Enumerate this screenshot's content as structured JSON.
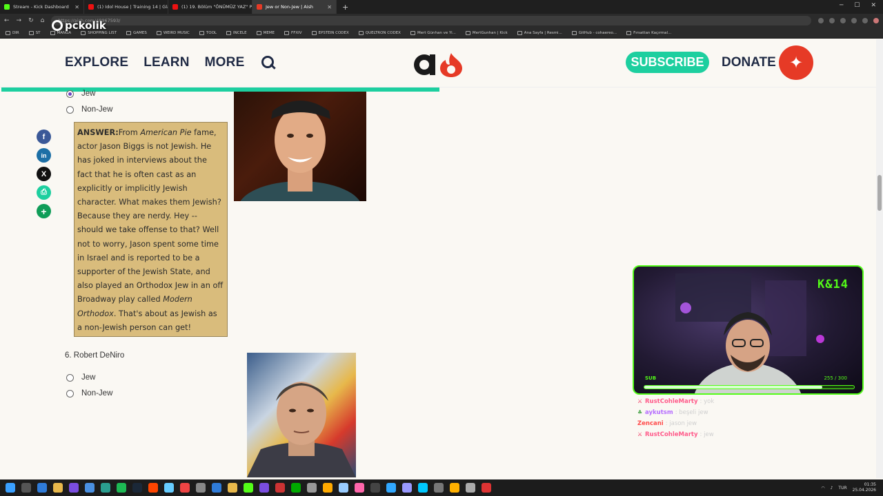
{
  "browser": {
    "tabs": [
      {
        "title": "Stream - Kick Dashboard",
        "color": "#53fc18",
        "active": false
      },
      {
        "title": "(1) Idol House | Training 14 | Glam",
        "color": "#e11",
        "active": false
      },
      {
        "title": "(1) 19. Bölüm \"ÖNÜMÜZ YAZ\" Pe",
        "color": "#e11",
        "active": false
      },
      {
        "title": "Jew or Non-Jew | Aish",
        "color": "#e63a26",
        "active": true
      }
    ],
    "new_tab": "+",
    "url": "https://aish.com/48967593/",
    "bookmarks": [
      "DIR",
      "ST",
      "MANGA",
      "SHOPPING LIST",
      "GAMES",
      "WEIRD MUSIC",
      "TOOL",
      "INCELE",
      "MEME",
      "FFXIV",
      "EPSTEIN CODEX",
      "QUELTRON CODEX",
      "Mert Günhan ve Yi...",
      "MertGunhan | Kick",
      "Ana Sayfa | Resmi...",
      "GitHub - cohaereo...",
      "Fırsattan Kaçırmal..."
    ]
  },
  "overlay_logo": "pckolik",
  "header": {
    "menu": [
      "EXPLORE",
      "LEARN",
      "MORE"
    ],
    "logo_text": "a",
    "subscribe": "SUBSCRIBE",
    "donate": "DONATE",
    "progress_fraction": 0.5
  },
  "share": {
    "icons": [
      "facebook-icon",
      "linkedin-icon",
      "x-icon",
      "print-icon",
      "plus-icon"
    ],
    "labels": [
      "f",
      "in",
      "X",
      "⎙",
      "+"
    ],
    "colors": [
      "#3b5998",
      "#1c6fa6",
      "#111111",
      "#1dcf9f",
      "#0f9d58"
    ]
  },
  "quiz": {
    "q5": {
      "options": [
        "Jew",
        "Non-Jew"
      ],
      "selected": "Jew"
    },
    "answer_label": "ANSWER:",
    "answer_pre": "From ",
    "answer_em1": "American Pie",
    "answer_mid": " fame, actor Jason Biggs is not Jewish. He has joked in interviews about the fact that he is often cast as an explicitly or implicitly Jewish character. What makes them Jewish? Because they are nerdy. Hey -- should we take offense to that? Well not to worry, Jason spent some time in Israel and is reported to be a supporter of the Jewish State, and also played an Orthodox Jew in an off Broadway play called ",
    "answer_em2": "Modern Orthodox",
    "answer_post": ". That's about as Jewish as a non-Jewish person can get!",
    "q6": {
      "title": "6. Robert DeNiro",
      "options": [
        "Jew",
        "Non-Jew"
      ]
    }
  },
  "stream": {
    "channel_tag": "K&14",
    "sub_label": "SUB",
    "sub_count": "255 / 300",
    "sub_progress": 0.85,
    "chat": [
      {
        "user": "RustCohleMarty",
        "color": "#ff5a8a",
        "msg": ": yok"
      },
      {
        "user": "aykutsm",
        "color": "#b56cff",
        "msg": ": beşeli jew"
      },
      {
        "user": "Zencani",
        "color": "#ff4a4a",
        "msg": ": jason jew"
      },
      {
        "user": "RustCohleMarty",
        "color": "#ff5a8a",
        "msg": ": jew"
      }
    ]
  },
  "taskbar": {
    "language": "TUR",
    "time": "01:35",
    "date": "25.04.2026"
  }
}
